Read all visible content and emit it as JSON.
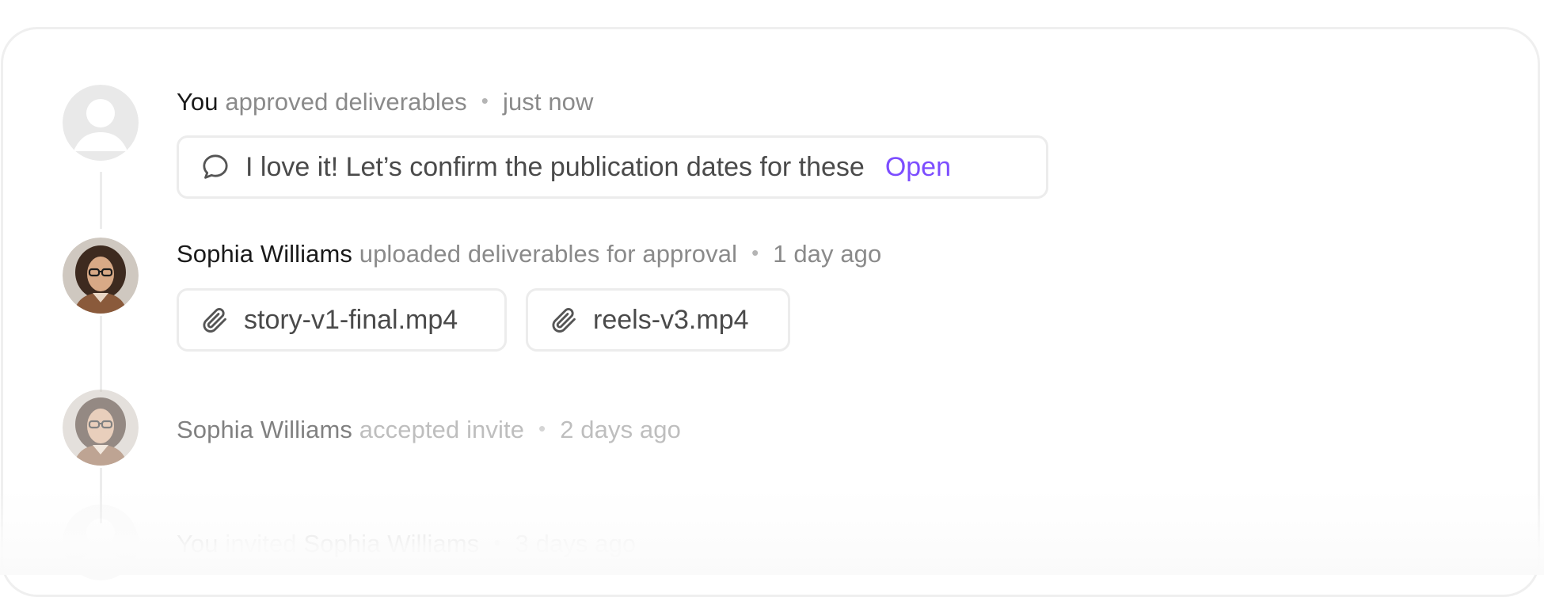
{
  "activity": [
    {
      "actor": "You",
      "action": "approved deliverables",
      "separator": "•",
      "time": "just now",
      "comment": {
        "text": "I love it! Let’s confirm the publication dates for these",
        "link_label": "Open"
      }
    },
    {
      "actor": "Sophia Williams",
      "action": "uploaded deliverables for approval",
      "separator": "•",
      "time": "1 day ago",
      "attachments": [
        {
          "name": "story-v1-final.mp4",
          "icon": "paperclip-icon"
        },
        {
          "name": "reels-v3.mp4",
          "icon": "paperclip-icon"
        }
      ]
    },
    {
      "actor": "Sophia Williams",
      "action": "accepted invite",
      "separator": "•",
      "time": "2 days ago"
    },
    {
      "actor": "You",
      "action": "invited",
      "target": "Sophia Williams",
      "separator": "•",
      "time": "3 days ago"
    }
  ],
  "colors": {
    "accent": "#7c4dff",
    "primary_text": "#1a1a1a",
    "secondary_text": "#8a8a8a",
    "border": "#ececec"
  }
}
